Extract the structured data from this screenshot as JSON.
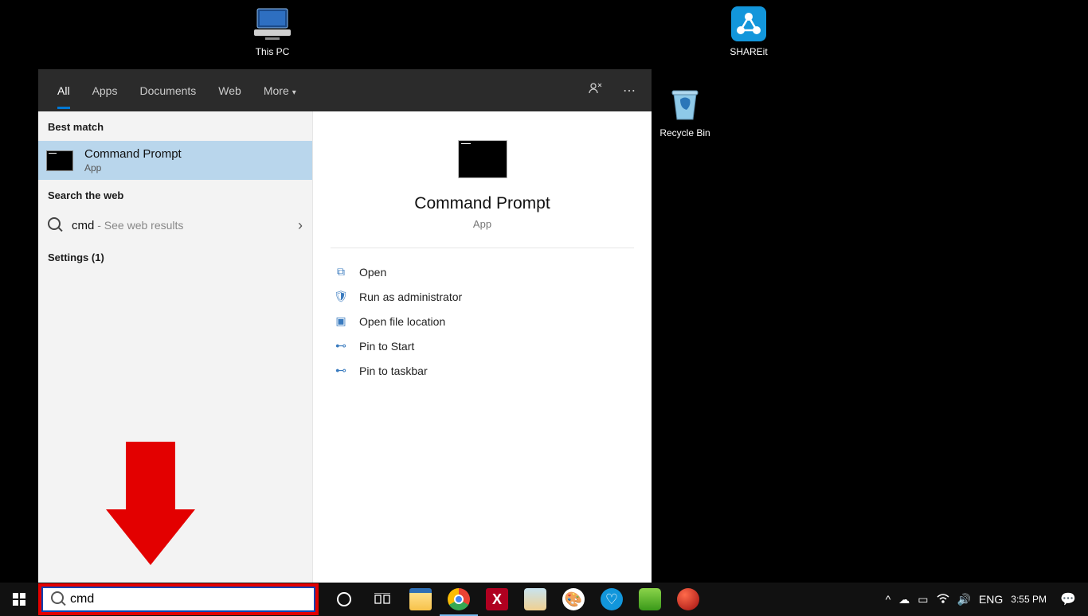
{
  "desktop": {
    "this_pc_label": "This PC",
    "shareit_label": "SHAREit",
    "recycle_bin_label": "Recycle Bin"
  },
  "search_panel": {
    "tabs": {
      "all": "All",
      "apps": "Apps",
      "documents": "Documents",
      "web": "Web",
      "more": "More"
    },
    "best_match_header": "Best match",
    "best_match": {
      "title": "Command Prompt",
      "subtitle": "App"
    },
    "search_web_header": "Search the web",
    "web_result": {
      "query": "cmd",
      "hint": " - See web results"
    },
    "settings_header": "Settings (1)",
    "preview": {
      "title": "Command Prompt",
      "subtitle": "App"
    },
    "actions": {
      "open": "Open",
      "run_admin": "Run as administrator",
      "open_loc": "Open file location",
      "pin_start": "Pin to Start",
      "pin_taskbar": "Pin to taskbar"
    }
  },
  "taskbar": {
    "search_value": "cmd",
    "lang": "ENG",
    "time": "3:55 PM"
  }
}
